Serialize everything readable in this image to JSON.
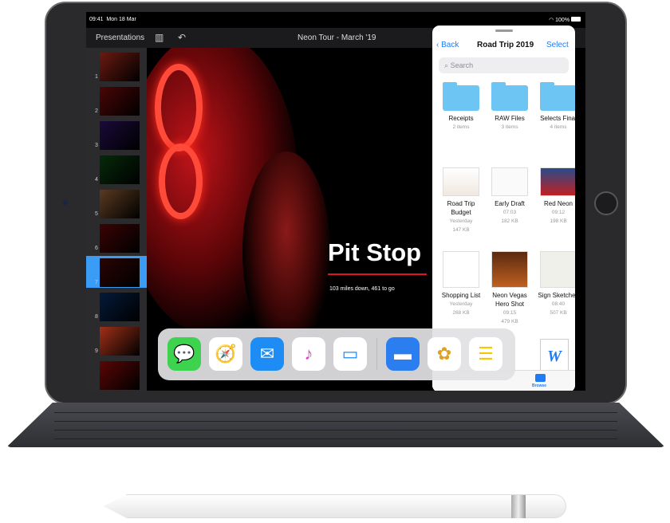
{
  "status_bar": {
    "time": "09:41",
    "date": "Mon 18 Mar",
    "battery": "100%"
  },
  "toolbar": {
    "presentations": "Presentations",
    "title": "Neon Tour - March '19",
    "icons": [
      "sidebar-icon",
      "undo-icon"
    ]
  },
  "navigator": {
    "slides": [
      "1",
      "2",
      "3",
      "4",
      "5",
      "6",
      "7",
      "8",
      "9"
    ],
    "selected": "7",
    "add_label": "+"
  },
  "slide": {
    "title": "Pit Stop",
    "subtitle": "103 miles down, 461 to go"
  },
  "files": {
    "back": "Back",
    "title": "Road Trip 2019",
    "select": "Select",
    "search_placeholder": "Search",
    "folders": [
      {
        "name": "Receipts",
        "meta": "2 items"
      },
      {
        "name": "RAW Files",
        "meta": "3 items"
      },
      {
        "name": "Selects Final",
        "meta": "4 items"
      }
    ],
    "docs": [
      {
        "name": "Road Trip Budget",
        "time": "Yesterday",
        "size": "147 KB"
      },
      {
        "name": "Early Draft",
        "time": "07:03",
        "size": "182 KB"
      },
      {
        "name": "Red Neon",
        "time": "09:12",
        "size": "198 KB"
      },
      {
        "name": "Shopping List",
        "time": "Yesterday",
        "size": "268 KB"
      },
      {
        "name": "Neon Vegas Hero Shot",
        "time": "09:15",
        "size": "479 KB"
      },
      {
        "name": "Sign Sketches",
        "time": "08:40",
        "size": "507 KB"
      }
    ],
    "browse": "Browse",
    "word_glyph": "W"
  },
  "dock": {
    "apps": [
      "Messages",
      "Safari",
      "Mail",
      "Music",
      "Files",
      "Keynote",
      "Photos",
      "Notes"
    ]
  },
  "colors": {
    "accent": "#1e7cf5",
    "slide_line": "#e0161a",
    "selected_slide": "#3b9cf5",
    "folder": "#6dc5f3"
  }
}
